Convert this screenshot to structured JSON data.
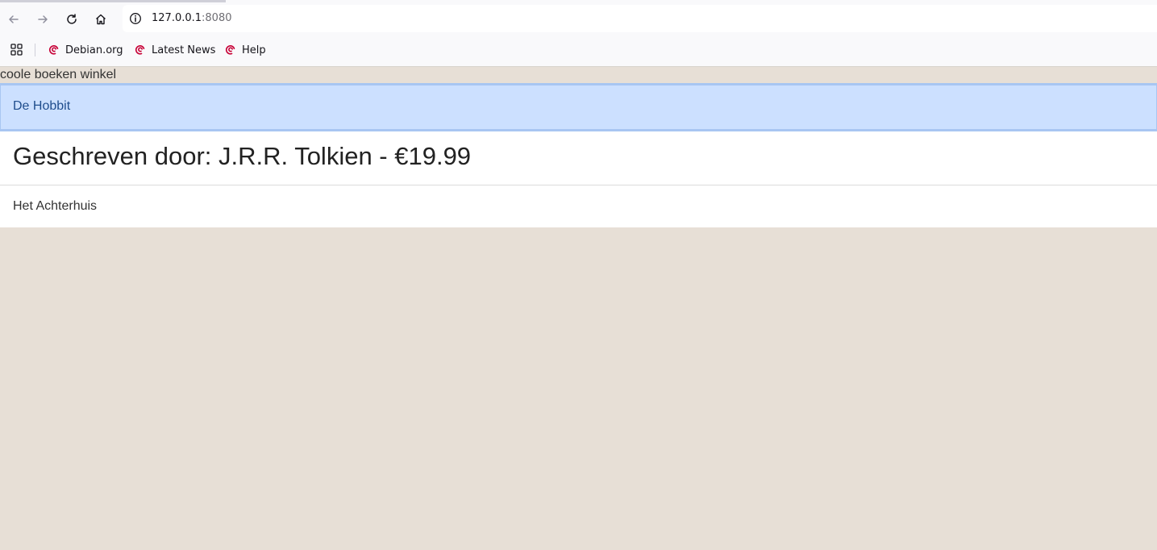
{
  "browser": {
    "url_host": "127.0.0.1",
    "url_port": ":8080",
    "bookmarks": [
      {
        "label": "Debian.org"
      },
      {
        "label": "Latest News"
      },
      {
        "label": "Help"
      }
    ]
  },
  "page": {
    "site_title": "coole boeken winkel",
    "books": [
      {
        "title": "De Hobbit",
        "selected": true
      },
      {
        "title": "Het Achterhuis",
        "selected": false
      }
    ],
    "detail": "Geschreven door: J.R.R. Tolkien - €19.99"
  },
  "colors": {
    "page_background": "#e7dfd6",
    "selected_item_background": "#cce0ff",
    "selected_item_text": "#1f4d8c",
    "bookmark_icon": "#c70036"
  },
  "icons": [
    "back-arrow-icon",
    "forward-arrow-icon",
    "reload-icon",
    "home-icon",
    "info-icon",
    "apps-grid-icon",
    "debian-swirl-icon"
  ]
}
